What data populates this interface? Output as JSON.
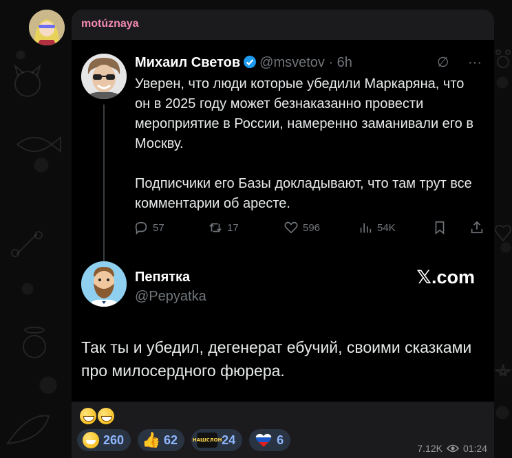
{
  "message": {
    "sender_name": "motúznaya",
    "caption_emoji": [
      "grinning-face-emoji",
      "grinning-face-emoji"
    ],
    "views": "7.12K",
    "time": "01:24"
  },
  "tweet": {
    "author_name": "Михаил Светов",
    "author_handle": "@msvetov · 6h",
    "tools": {
      "grok_icon": "∅",
      "more_icon": "···"
    },
    "text": "Уверен, что люди которые убедили Маркаряна, что он в 2025 году может безнаказанно провести мероприятие в России, намеренно заманивали его в Москву.\n\nПодписчики его Базы докладывают, что там трут все комментарии об аресте.",
    "stats": {
      "replies": "57",
      "retweets": "17",
      "likes": "596",
      "views": "54K"
    }
  },
  "reply": {
    "author_name": "Пепятка",
    "author_handle": "@Pepyatka",
    "source": "𝕏.com",
    "text": "Так ты и убедил, дегенерат ебучий, своими сказками про милосердного фюрера."
  },
  "reactions": [
    {
      "icon": "grinning-face-emoji",
      "count": "260"
    },
    {
      "icon": "thumbs-up-emoji",
      "count": "62"
    },
    {
      "icon": "nash-slon-custom-emoji",
      "label_line1": "НАШ",
      "label_line2": "СЛОН",
      "count": "24"
    },
    {
      "icon": "russian-flag-heart-emoji",
      "count": "6"
    }
  ],
  "colors": {
    "sender_name": "#f38ab3",
    "verified_badge": "#1d9bf0",
    "reaction_bg": "#2a3342",
    "reaction_text": "#8fb8ff"
  }
}
